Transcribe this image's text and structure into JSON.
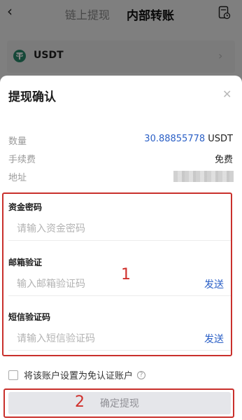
{
  "background": {
    "nav_tab_chain": "链上提现",
    "nav_tab_internal": "内部转账",
    "coin": "USDT"
  },
  "sheet": {
    "title": "提现确认",
    "amount_label": "数量",
    "amount_value": "30.88855778",
    "amount_unit": "USDT",
    "fee_label": "手续费",
    "fee_value": "免费",
    "address_label": "地址"
  },
  "fields": [
    {
      "label": "资金密码",
      "placeholder": "请输入资金密码"
    },
    {
      "label": "邮箱验证",
      "placeholder": "输入邮箱验证码",
      "action": "发送"
    },
    {
      "label": "短信验证码",
      "placeholder": "请输入短信验证码",
      "action": "发送"
    }
  ],
  "annotations": {
    "marker1": "1",
    "marker2": "2"
  },
  "exempt_label": "将该账户设置为免认证账户",
  "confirm_label": "确定提现",
  "colors": {
    "accent_blue": "#2a5fc6",
    "annotation_red": "#c9302c"
  }
}
